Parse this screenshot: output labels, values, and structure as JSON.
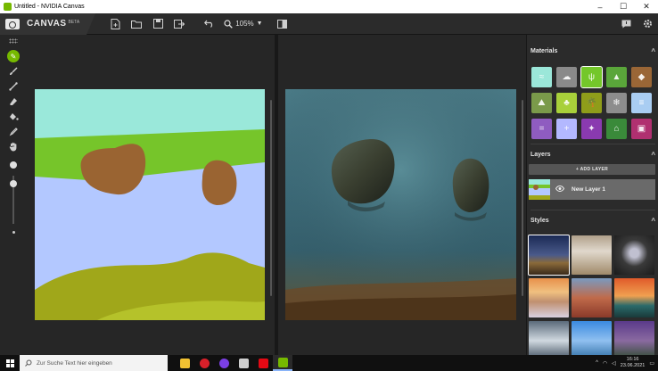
{
  "window": {
    "title": "Untitled - NVIDIA Canvas",
    "min_glyph": "–",
    "max_glyph": "☐",
    "close_glyph": "✕"
  },
  "toolbar": {
    "brand": "CANVAS",
    "beta": "BETA",
    "new_icon": "new-file-icon",
    "open_icon": "open-folder-icon",
    "save_icon": "save-icon",
    "export_icon": "export-icon",
    "undo_icon": "undo-icon",
    "zoom_value": "105%",
    "zoom_caret": "▼",
    "layout_icon": "layout-icon",
    "feedback_icon": "feedback-icon",
    "settings_icon": "gear-icon"
  },
  "tools": [
    {
      "name": "tool-brush-green",
      "glyph": "✎"
    },
    {
      "name": "tool-brush",
      "glyph": "🖌"
    },
    {
      "name": "tool-line",
      "glyph": "╱"
    },
    {
      "name": "tool-eraser",
      "glyph": "⌫"
    },
    {
      "name": "tool-fill",
      "glyph": "◆"
    },
    {
      "name": "tool-eyedropper",
      "glyph": "✒"
    },
    {
      "name": "tool-pan",
      "glyph": "✋"
    }
  ],
  "brush_size": 0.1,
  "panel": {
    "materials_title": "Materials",
    "layers_title": "Layers",
    "styles_title": "Styles",
    "chevron": "^",
    "add_layer": "+ ADD LAYER",
    "layer_name": "New Layer 1",
    "eye_glyph": "👁"
  },
  "materials": [
    {
      "name": "material-water",
      "color": "#9be7d9",
      "glyph": "≈"
    },
    {
      "name": "material-cloud",
      "color": "#8a8a8a",
      "glyph": "☁"
    },
    {
      "name": "material-grass",
      "color": "#74c72a",
      "glyph": "ψ"
    },
    {
      "name": "material-hill",
      "color": "#5aa63a",
      "glyph": "▲"
    },
    {
      "name": "material-rock",
      "color": "#9a6636",
      "glyph": "◆"
    },
    {
      "name": "material-mountain",
      "color": "#7a9a4a",
      "glyph": "⛰"
    },
    {
      "name": "material-tree",
      "color": "#a8d03a",
      "glyph": "♣"
    },
    {
      "name": "material-palm",
      "color": "#8f9d1a",
      "glyph": "🌴"
    },
    {
      "name": "material-snow",
      "color": "#8d8d8d",
      "glyph": "❄"
    },
    {
      "name": "material-sky",
      "color": "#a9cdf2",
      "glyph": "≡"
    },
    {
      "name": "material-road",
      "color": "#8f5cc0",
      "glyph": "="
    },
    {
      "name": "material-fog",
      "color": "#b3b8ff",
      "glyph": "+"
    },
    {
      "name": "material-flowers",
      "color": "#8a3ab0",
      "glyph": "✦"
    },
    {
      "name": "material-house",
      "color": "#3a8a3a",
      "glyph": "⌂"
    },
    {
      "name": "material-building",
      "color": "#b03070",
      "glyph": "▣"
    }
  ],
  "selected_material": 2,
  "styles": [
    {
      "name": "style-1",
      "bg": "linear-gradient(#1b2a55, #4a5a8a 50%, #8a6a3a 70%, #3a2a1a)"
    },
    {
      "name": "style-2",
      "bg": "linear-gradient(#b0a08a, #e0d8cc 40%, #a08a6a)"
    },
    {
      "name": "style-3",
      "bg": "radial-gradient(circle at 50% 45%, #c0c0d0 15%, #3a3a3a 45%, #1a1a1a)"
    },
    {
      "name": "style-4",
      "bg": "linear-gradient(#e8904a, #f0c080 35%, #c09070 60%, #d8d0e0)"
    },
    {
      "name": "style-5",
      "bg": "linear-gradient(#7a9ac0, #c06a4a 50%, #8a3a2a)"
    },
    {
      "name": "style-6",
      "bg": "linear-gradient(#e05a2a, #f0a050 45%, #2a6a6a 70%, #1a3a3a)"
    },
    {
      "name": "style-7",
      "bg": "linear-gradient(#5a6a7a, #d0d8e0 50%, #3a4a5a)"
    },
    {
      "name": "style-8",
      "bg": "linear-gradient(#3a8ae0, #90c0f0 50%, #2a6aa0)"
    },
    {
      "name": "style-9",
      "bg": "linear-gradient(#5a3a8a, #8a6aa0 50%, #2a4a2a)"
    }
  ],
  "selected_style": 0,
  "taskbar": {
    "search_placeholder": "Zur Suche Text hier eingeben",
    "time": "16:16",
    "date": "23.06.2021",
    "apps": [
      {
        "name": "taskbar-file-explorer",
        "color": "#f2c232"
      },
      {
        "name": "taskbar-opera",
        "color": "#d8202a"
      },
      {
        "name": "taskbar-browser",
        "color": "#7b3fe4"
      },
      {
        "name": "taskbar-app-gray",
        "color": "#cfcfcf"
      },
      {
        "name": "taskbar-netflix",
        "color": "#e50914"
      },
      {
        "name": "taskbar-nvidia-canvas",
        "color": "#76b900"
      }
    ]
  }
}
